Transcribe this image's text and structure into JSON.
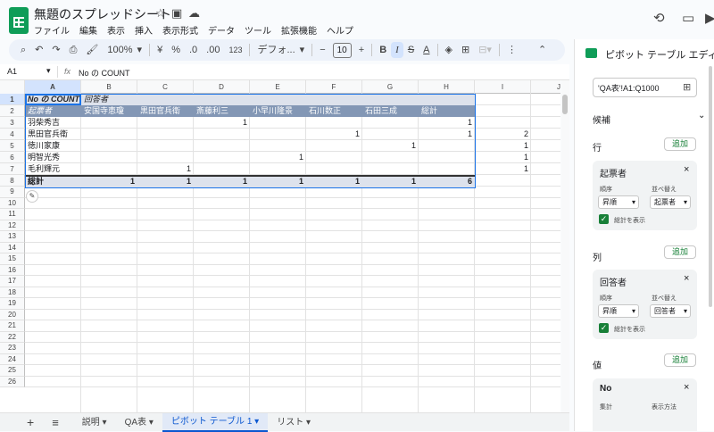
{
  "app": {
    "doc_title": "無題のスプレッドシート",
    "menus": [
      "ファイル",
      "編集",
      "表示",
      "挿入",
      "表示形式",
      "データ",
      "ツール",
      "拡張機能",
      "ヘルプ"
    ]
  },
  "toolbar": {
    "zoom": "100%",
    "currency": "¥",
    "percent": "%",
    "dec_minus": ".0",
    "dec_plus": ".00",
    "fmt123": "123",
    "font": "デフォ...",
    "font_size": "10"
  },
  "formula_bar": {
    "cell_ref": "A1",
    "fx": "fx",
    "value": "No の COUNT"
  },
  "grid": {
    "columns": [
      "A",
      "B",
      "C",
      "D",
      "E",
      "F",
      "G",
      "H",
      "I",
      "J"
    ],
    "rows": [
      "1",
      "2",
      "3",
      "4",
      "5",
      "6",
      "7",
      "8",
      "9",
      "10",
      "11",
      "12",
      "13",
      "14",
      "15",
      "16",
      "17",
      "18",
      "19",
      "20",
      "21",
      "22",
      "23",
      "24",
      "25",
      "26"
    ],
    "pivot_title": "No の COUNT",
    "pivot_col_field": "回答者",
    "pivot_row_field": "起票者",
    "col_names": [
      "安国寺恵瓊",
      "黒田官兵衛",
      "斎藤利三",
      "小早川隆景",
      "石川数正",
      "石田三成",
      "総計"
    ],
    "body": [
      {
        "name": "羽柴秀吉",
        "vals": [
          "",
          "",
          "1",
          "",
          "",
          "",
          "1"
        ]
      },
      {
        "name": "黒田官兵衛",
        "vals": [
          "",
          "",
          "",
          "",
          "1",
          "",
          "1",
          "2"
        ]
      },
      {
        "name": "徳川家康",
        "vals": [
          "",
          "",
          "",
          "",
          "",
          "1",
          "",
          "1"
        ]
      },
      {
        "name": "明智光秀",
        "vals": [
          "",
          "",
          "",
          "1",
          "",
          "",
          "",
          "1"
        ]
      },
      {
        "name": "毛利輝元",
        "vals": [
          "",
          "1",
          "",
          "",
          "",
          "",
          "",
          "1"
        ]
      }
    ],
    "total_label": "総計",
    "totals": [
      "1",
      "1",
      "1",
      "1",
      "1",
      "1",
      "6"
    ]
  },
  "sheet_tabs": [
    "説明",
    "QA表",
    "ピボット テーブル 1",
    "リスト"
  ],
  "active_tab": "ピボット テーブル 1",
  "panel": {
    "title": "ピボット テーブル エディタ",
    "range": "'QA表'!A1:Q1000",
    "suggest": "候補",
    "rows_label": "行",
    "cols_label": "列",
    "values_label": "値",
    "add": "追加",
    "row_field": "起票者",
    "col_field": "回答者",
    "value_field": "No",
    "order": "順序",
    "sort_by": "並べ替え",
    "asc": "昇順",
    "show_total": "総計を表示",
    "agg": "集計",
    "display": "表示方法"
  },
  "colors": {
    "pivot_header": "#8397b5",
    "pivot_light": "#dde2ec",
    "accent": "#188038",
    "active_blue": "#0b57d0"
  }
}
